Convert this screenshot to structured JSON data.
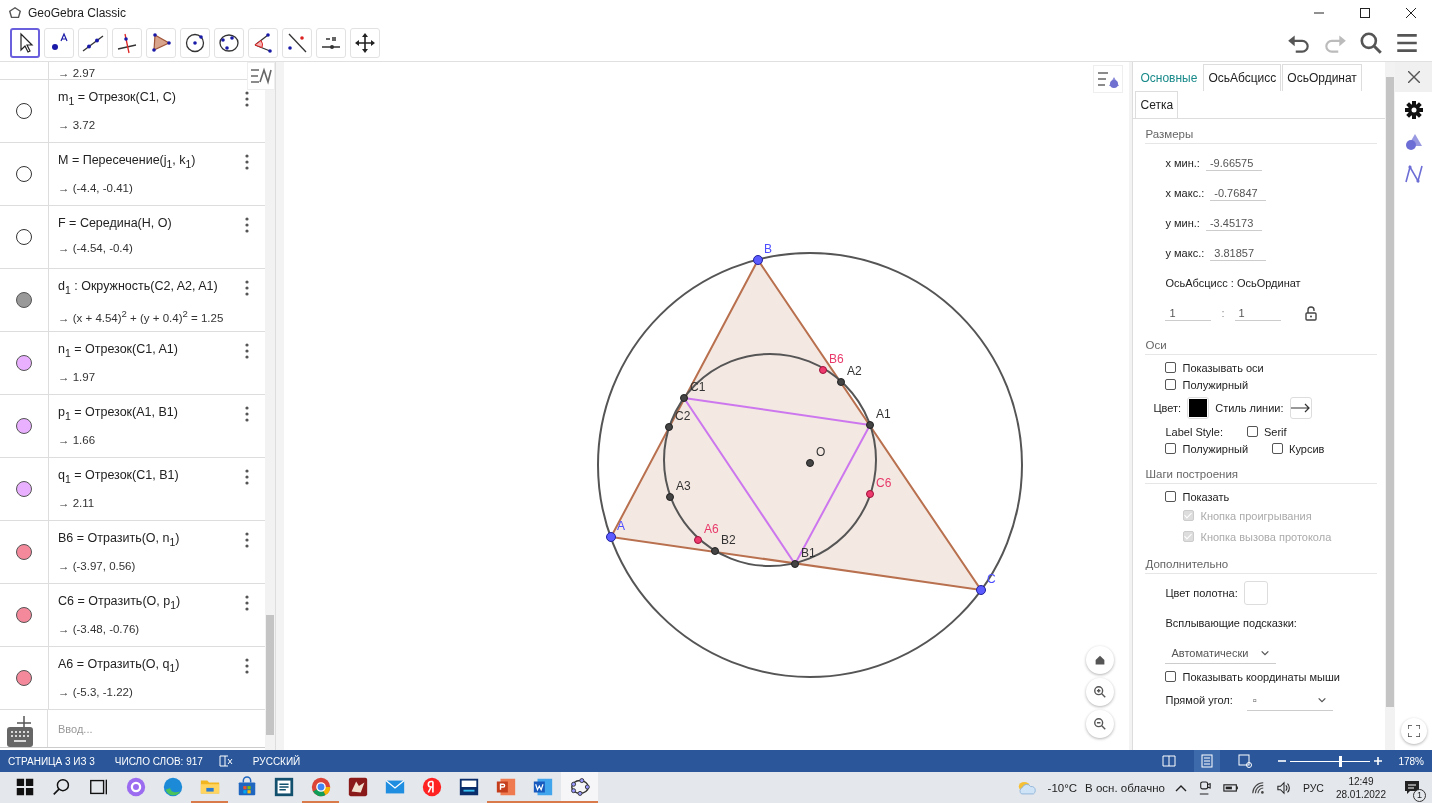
{
  "window": {
    "title": "GeoGebra Classic"
  },
  "toolbar": {
    "tools": [
      {
        "kind": "move",
        "selected": true
      },
      {
        "kind": "point",
        "selected": false
      },
      {
        "kind": "line",
        "selected": false
      },
      {
        "kind": "perpendicular",
        "selected": false
      },
      {
        "kind": "polygon",
        "selected": false
      },
      {
        "kind": "circle",
        "selected": false
      },
      {
        "kind": "circle3",
        "selected": false
      },
      {
        "kind": "angle",
        "selected": false
      },
      {
        "kind": "reflect",
        "selected": false
      },
      {
        "kind": "slider",
        "selected": false
      },
      {
        "kind": "moveview",
        "selected": false
      }
    ],
    "actions": [
      {
        "kind": "undo",
        "disabled": false
      },
      {
        "kind": "redo",
        "disabled": true
      },
      {
        "kind": "search",
        "disabled": false
      },
      {
        "kind": "menu",
        "disabled": false
      }
    ]
  },
  "algebra": {
    "items": [
      {
        "kind": "partial",
        "output": "→ 2.97"
      },
      {
        "kind": "object",
        "definition": "m$_{1}$ = Отрезок(C1, C)",
        "output": "→ 3.72",
        "visible": false
      },
      {
        "kind": "object",
        "definition": "M = Пересечение(j$_{1}$, k$_{1}$)",
        "output": "→ (-4.4, -0.41)",
        "visible": false
      },
      {
        "kind": "object",
        "definition": "F = Середина(H, O)",
        "output": "→ (-4.54, -0.4)",
        "visible": false
      },
      {
        "kind": "object",
        "definition": "d$_{1}$ : Окружность(C2, A2, A1)",
        "output": "→ (x + 4.54)$^{2}$ + (y + 0.4)$^{2}$ = 1.25",
        "visible": true,
        "color": "#999999"
      },
      {
        "kind": "object",
        "definition": "n$_{1}$ = Отрезок(C1, A1)",
        "output": "→ 1.97",
        "visible": true,
        "color": "#e8b0ff"
      },
      {
        "kind": "object",
        "definition": "p$_{1}$ = Отрезок(A1, B1)",
        "output": "→ 1.66",
        "visible": true,
        "color": "#e8b0ff"
      },
      {
        "kind": "object",
        "definition": "q$_{1}$ = Отрезок(C1, B1)",
        "output": "→ 2.11",
        "visible": true,
        "color": "#e8b0ff"
      },
      {
        "kind": "object",
        "definition": "B6 = Отразить(O, n$_{1}$)",
        "output": "→ (-3.97, 0.56)",
        "visible": true,
        "color": "#f4899c"
      },
      {
        "kind": "object",
        "definition": "C6 = Отразить(O, p$_{1}$)",
        "output": "→ (-3.48, -0.76)",
        "visible": true,
        "color": "#f4899c"
      },
      {
        "kind": "object",
        "definition": "A6 = Отразить(O, q$_{1}$)",
        "output": "→ (-5.3, -1.22)",
        "visible": true,
        "color": "#f4899c"
      }
    ],
    "input": {
      "placeholder": "Ввод..."
    }
  },
  "canvas": {
    "points": [
      {
        "label": "A",
        "kind": "free"
      },
      {
        "label": "B",
        "kind": "free"
      },
      {
        "label": "C",
        "kind": "free"
      },
      {
        "label": "O",
        "kind": "derived"
      },
      {
        "label": "C1",
        "kind": "derived"
      },
      {
        "label": "C2",
        "kind": "derived"
      },
      {
        "label": "A3",
        "kind": "derived"
      },
      {
        "label": "A6",
        "kind": "reflected"
      },
      {
        "label": "B2",
        "kind": "derived"
      },
      {
        "label": "B1",
        "kind": "derived"
      },
      {
        "label": "C6",
        "kind": "reflected"
      },
      {
        "label": "A1",
        "kind": "derived"
      },
      {
        "label": "A2",
        "kind": "derived"
      },
      {
        "label": "B6",
        "kind": "reflected"
      }
    ]
  },
  "settings": {
    "tabs": [
      {
        "label": "Основные",
        "selected": true
      },
      {
        "label": "ОсьАбсцисс",
        "selected": false
      },
      {
        "label": "ОсьОрдинат",
        "selected": false
      },
      {
        "label": "Сетка",
        "selected": false
      }
    ],
    "sections": [
      {
        "title": "Размеры",
        "rows": [
          {
            "kind": "field",
            "label": "x мин.:",
            "value": "-9.66575"
          },
          {
            "kind": "field",
            "label": "x макс.:",
            "value": "-0.76847"
          },
          {
            "kind": "field",
            "label": "y мин.:",
            "value": "-3.45173"
          },
          {
            "kind": "field",
            "label": "y макс.:",
            "value": "3.81857"
          },
          {
            "kind": "text",
            "text": "ОсьАбсцисс : ОсьОрдинат"
          },
          {
            "kind": "ratio",
            "values": [
              "1",
              "1"
            ],
            "separator": ":",
            "locked": false
          }
        ]
      },
      {
        "title": "Оси",
        "rows": [
          {
            "kind": "checks",
            "items": [
              {
                "label": "Показывать оси",
                "checked": false,
                "disabled": false
              }
            ]
          },
          {
            "kind": "checks",
            "items": [
              {
                "label": "Полужирный",
                "checked": false,
                "disabled": false
              }
            ]
          },
          {
            "kind": "style",
            "color_label": "Цвет:",
            "color": "#000000",
            "line_label": "Стиль линии:"
          },
          {
            "kind": "checks",
            "label": "Label Style:",
            "items": [
              {
                "label": "Serif",
                "checked": false,
                "disabled": false
              }
            ]
          },
          {
            "kind": "checks",
            "items": [
              {
                "label": "Полужирный",
                "checked": false,
                "disabled": false
              },
              {
                "label": "Курсив",
                "checked": false,
                "disabled": false
              }
            ]
          }
        ]
      },
      {
        "title": "Шаги построения",
        "rows": [
          {
            "kind": "checks",
            "items": [
              {
                "label": "Показать",
                "checked": false,
                "disabled": false,
                "children": [
                  {
                    "label": "Кнопка проигрывания",
                    "checked": true,
                    "disabled": true
                  },
                  {
                    "label": "Кнопка вызова протокола",
                    "checked": true,
                    "disabled": true
                  }
                ]
              }
            ]
          }
        ]
      },
      {
        "title": "Дополнительно",
        "rows": [
          {
            "kind": "color",
            "label": "Цвет полотна:",
            "color": "#ffffff"
          },
          {
            "kind": "text",
            "text": "Всплывающие подсказки:"
          },
          {
            "kind": "select",
            "value": "Автоматически"
          },
          {
            "kind": "checks",
            "items": [
              {
                "label": "Показывать координаты мыши",
                "checked": false,
                "disabled": false
              }
            ]
          },
          {
            "kind": "select",
            "label": "Прямой угол:",
            "value": "▫"
          }
        ]
      }
    ]
  },
  "side_tabs": [
    {
      "kind": "gear",
      "selected": true
    },
    {
      "kind": "shapes",
      "selected": false
    },
    {
      "kind": "graph",
      "selected": false
    }
  ],
  "word_status": {
    "page": "СТРАНИЦА 3 ИЗ 3",
    "words": "ЧИСЛО СЛОВ: 917",
    "language": "РУССКИЙ",
    "views": [
      {
        "kind": "read",
        "selected": false
      },
      {
        "kind": "print",
        "selected": true
      },
      {
        "kind": "web",
        "selected": false
      }
    ],
    "zoom": {
      "level": 0.62,
      "reading": "178%"
    }
  },
  "taskbar": {
    "apps": [
      {
        "kind": "start",
        "running": false,
        "selected": false
      },
      {
        "kind": "search",
        "running": false,
        "selected": false
      },
      {
        "kind": "taskview",
        "running": false,
        "selected": false
      },
      {
        "kind": "alice",
        "running": false,
        "selected": false
      },
      {
        "kind": "edge",
        "running": false,
        "selected": false
      },
      {
        "kind": "explorer",
        "running": true,
        "selected": false
      },
      {
        "kind": "store",
        "running": false,
        "selected": false
      },
      {
        "kind": "reader",
        "running": false,
        "selected": false
      },
      {
        "kind": "chrome",
        "running": true,
        "selected": false
      },
      {
        "kind": "game",
        "running": false,
        "selected": false
      },
      {
        "kind": "mail",
        "running": false,
        "selected": false
      },
      {
        "kind": "yandex",
        "running": false,
        "selected": false
      },
      {
        "kind": "ide",
        "running": false,
        "selected": false
      },
      {
        "kind": "powerpoint",
        "running": true,
        "selected": false
      },
      {
        "kind": "word",
        "running": true,
        "selected": false
      },
      {
        "kind": "geogebra",
        "running": true,
        "selected": true
      }
    ],
    "weather": {
      "temperature": "-10°C",
      "condition": "В осн. облачно"
    },
    "language": "РУС",
    "time": "12:49",
    "date": "28.01.2022",
    "notifications": "1"
  }
}
